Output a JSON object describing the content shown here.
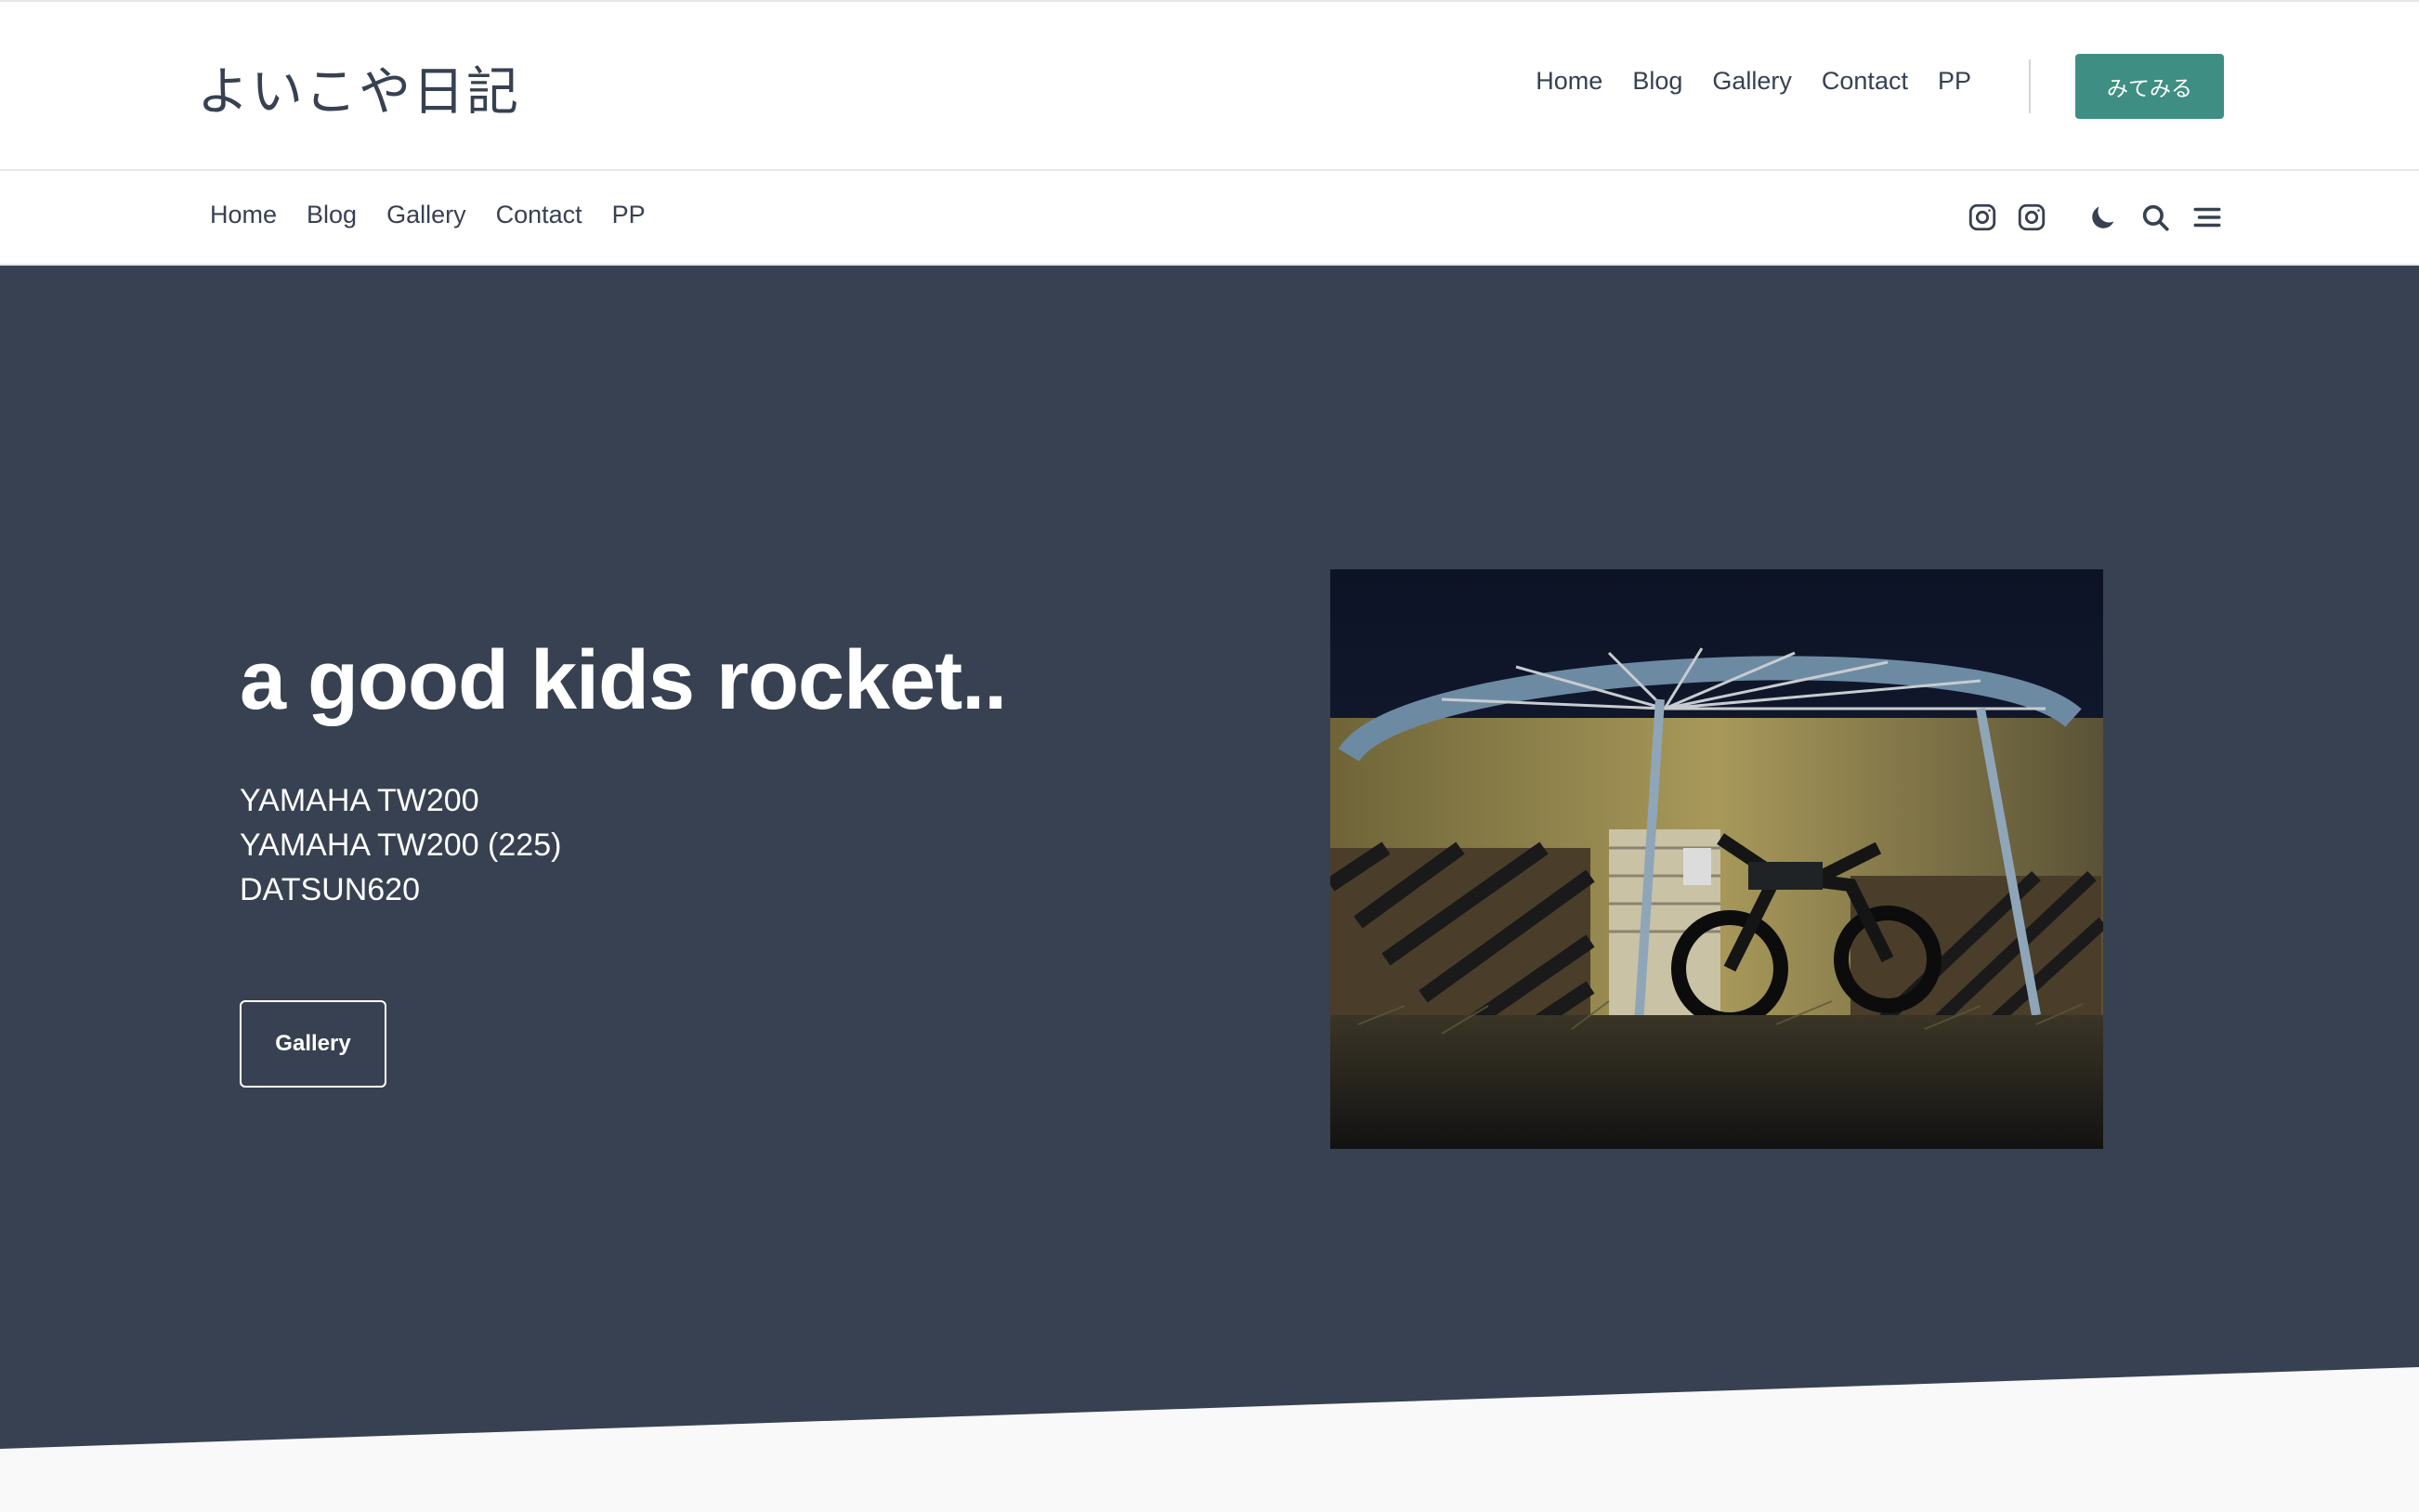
{
  "site": {
    "title": "よいこや日記"
  },
  "header": {
    "nav": [
      "Home",
      "Blog",
      "Gallery",
      "Contact",
      "PP"
    ],
    "cta_label": "みてみる"
  },
  "subnav": {
    "items": [
      "Home",
      "Blog",
      "Gallery",
      "Contact",
      "PP"
    ],
    "icons": [
      "instagram-icon",
      "instagram-icon",
      "moon-icon",
      "search-icon",
      "menu-icon"
    ]
  },
  "hero": {
    "title": "a good kids rocket..",
    "lines": [
      "YAMAHA TW200",
      "YAMAHA TW200 (225)",
      "DATSUN620"
    ],
    "button_label": "Gallery",
    "background": "#374151"
  },
  "colors": {
    "accent": "#3f8e83",
    "hero_bg": "#374151",
    "footer_bg": "#f9f9f9"
  }
}
